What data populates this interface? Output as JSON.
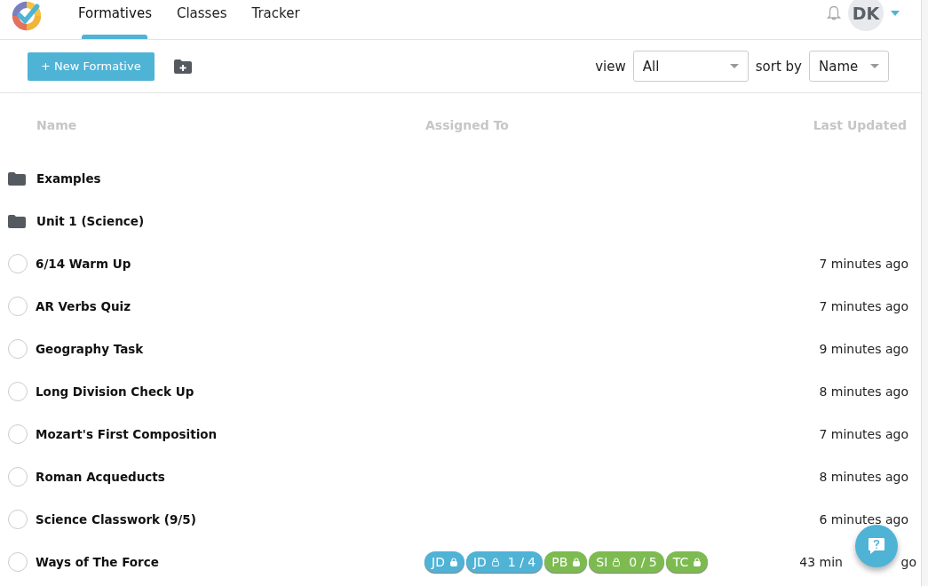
{
  "nav": {
    "tabs": [
      {
        "label": "Formatives",
        "selected": true
      },
      {
        "label": "Classes",
        "selected": false
      },
      {
        "label": "Tracker",
        "selected": false
      }
    ],
    "user_initials": "DK"
  },
  "toolbar": {
    "new_button": "+ New Formative",
    "view_label": "view",
    "view_value": "All",
    "sort_label": "sort by",
    "sort_value": "Name"
  },
  "table": {
    "columns": [
      "Name",
      "Assigned To",
      "Last Updated"
    ],
    "rows": [
      {
        "kind": "folder",
        "name": "Examples"
      },
      {
        "kind": "folder",
        "name": "Unit 1 (Science)"
      },
      {
        "kind": "formative",
        "checked": false,
        "name": "6/14 Warm Up",
        "updated": "7 minutes ago"
      },
      {
        "kind": "formative",
        "checked": false,
        "name": "AR Verbs Quiz",
        "updated": "7 minutes ago"
      },
      {
        "kind": "formative",
        "checked": false,
        "name": "Geography Task",
        "updated": "9 minutes ago"
      },
      {
        "kind": "formative",
        "checked": false,
        "name": "Long Division Check Up",
        "updated": "8 minutes ago"
      },
      {
        "kind": "formative",
        "checked": false,
        "name": "Mozart's First Composition",
        "updated": "7 minutes ago"
      },
      {
        "kind": "formative",
        "checked": false,
        "name": "Roman Acqueducts",
        "updated": "8 minutes ago"
      },
      {
        "kind": "formative",
        "checked": false,
        "name": "Science Classwork (9/5)",
        "updated": "6 minutes ago"
      },
      {
        "kind": "formative",
        "checked": false,
        "name": "Ways of The Force",
        "updated": "43 min",
        "updated_tail": "go",
        "assigned": [
          {
            "label": "JD",
            "locked": true,
            "color": "#4fb3d6"
          },
          {
            "label": "JD",
            "locked": false,
            "count": "1 / 4",
            "color": "#4fb3d6"
          },
          {
            "label": "PB",
            "locked": true,
            "color": "#7dbb51"
          },
          {
            "label": "SI",
            "locked": false,
            "count": "0 / 5",
            "color": "#7dbb51"
          },
          {
            "label": "TC",
            "locked": true,
            "color": "#7dbb51"
          }
        ]
      }
    ]
  }
}
